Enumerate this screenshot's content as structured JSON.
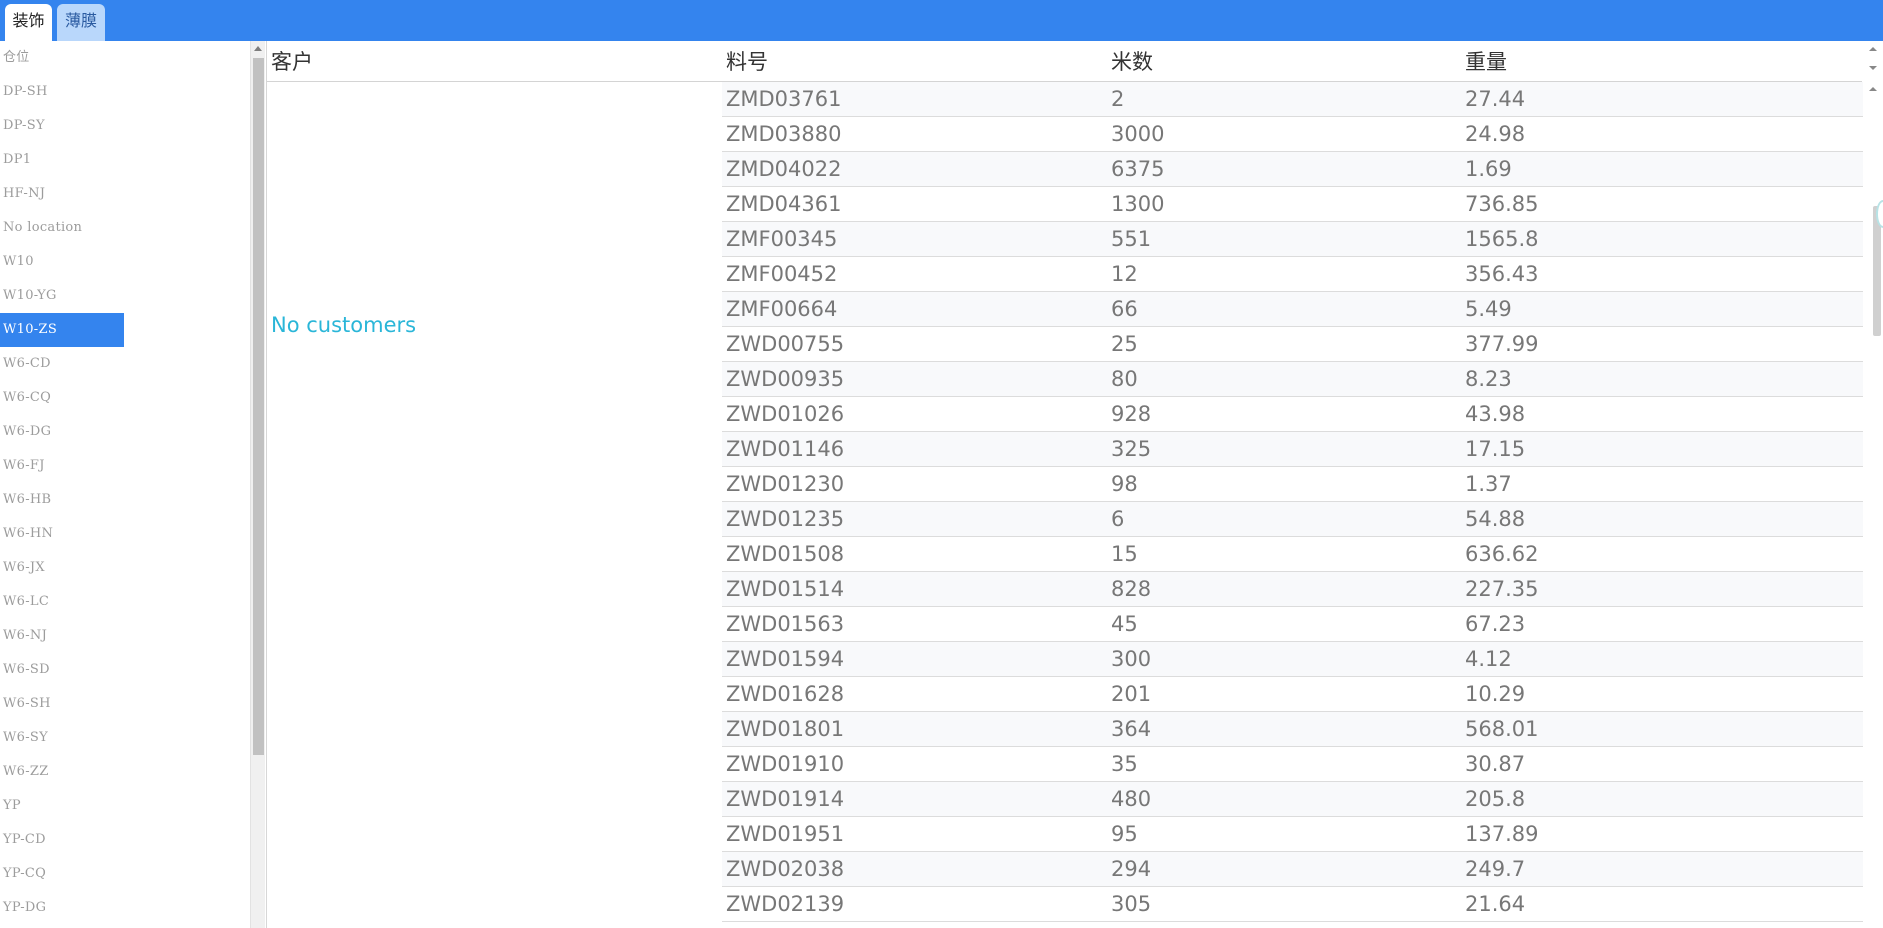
{
  "tabs": [
    {
      "label": "装饰",
      "active": true
    },
    {
      "label": "薄膜",
      "active": false
    }
  ],
  "locations": [
    {
      "label": "仓位",
      "selected": false
    },
    {
      "label": "DP-SH",
      "selected": false
    },
    {
      "label": "DP-SY",
      "selected": false
    },
    {
      "label": "DP1",
      "selected": false
    },
    {
      "label": "HF-NJ",
      "selected": false
    },
    {
      "label": "No location",
      "selected": false
    },
    {
      "label": "W10",
      "selected": false
    },
    {
      "label": "W10-YG",
      "selected": false
    },
    {
      "label": "W10-ZS",
      "selected": true
    },
    {
      "label": "W6-CD",
      "selected": false
    },
    {
      "label": "W6-CQ",
      "selected": false
    },
    {
      "label": "W6-DG",
      "selected": false
    },
    {
      "label": "W6-FJ",
      "selected": false
    },
    {
      "label": "W6-HB",
      "selected": false
    },
    {
      "label": "W6-HN",
      "selected": false
    },
    {
      "label": "W6-JX",
      "selected": false
    },
    {
      "label": "W6-LC",
      "selected": false
    },
    {
      "label": "W6-NJ",
      "selected": false
    },
    {
      "label": "W6-SD",
      "selected": false
    },
    {
      "label": "W6-SH",
      "selected": false
    },
    {
      "label": "W6-SY",
      "selected": false
    },
    {
      "label": "W6-ZZ",
      "selected": false
    },
    {
      "label": "YP",
      "selected": false
    },
    {
      "label": "YP-CD",
      "selected": false
    },
    {
      "label": "YP-CQ",
      "selected": false
    },
    {
      "label": "YP-DG",
      "selected": false
    }
  ],
  "table": {
    "headers": {
      "customer": "客户",
      "part_no": "料号",
      "meters": "米数",
      "weight": "重量"
    },
    "no_customers": "No customers",
    "rows": [
      [
        "ZMD03761",
        "2",
        "27.44"
      ],
      [
        "ZMD03880",
        "3000",
        "24.98"
      ],
      [
        "ZMD04022",
        "6375",
        "1.69"
      ],
      [
        "ZMD04361",
        "1300",
        "736.85"
      ],
      [
        "ZMF00345",
        "551",
        "1565.8"
      ],
      [
        "ZMF00452",
        "12",
        "356.43"
      ],
      [
        "ZMF00664",
        "66",
        "5.49"
      ],
      [
        "ZWD00755",
        "25",
        "377.99"
      ],
      [
        "ZWD00935",
        "80",
        "8.23"
      ],
      [
        "ZWD01026",
        "928",
        "43.98"
      ],
      [
        "ZWD01146",
        "325",
        "17.15"
      ],
      [
        "ZWD01230",
        "98",
        "1.37"
      ],
      [
        "ZWD01235",
        "6",
        "54.88"
      ],
      [
        "ZWD01508",
        "15",
        "636.62"
      ],
      [
        "ZWD01514",
        "828",
        "227.35"
      ],
      [
        "ZWD01563",
        "45",
        "67.23"
      ],
      [
        "ZWD01594",
        "300",
        "4.12"
      ],
      [
        "ZWD01628",
        "201",
        "10.29"
      ],
      [
        "ZWD01801",
        "364",
        "568.01"
      ],
      [
        "ZWD01910",
        "35",
        "30.87"
      ],
      [
        "ZWD01914",
        "480",
        "205.8"
      ],
      [
        "ZWD01951",
        "95",
        "137.89"
      ],
      [
        "ZWD02038",
        "294",
        "249.7"
      ],
      [
        "ZWD02139",
        "305",
        "21.64"
      ]
    ]
  },
  "colors": {
    "accent": "#3484ee",
    "no_customers": "#2ab6d8"
  }
}
